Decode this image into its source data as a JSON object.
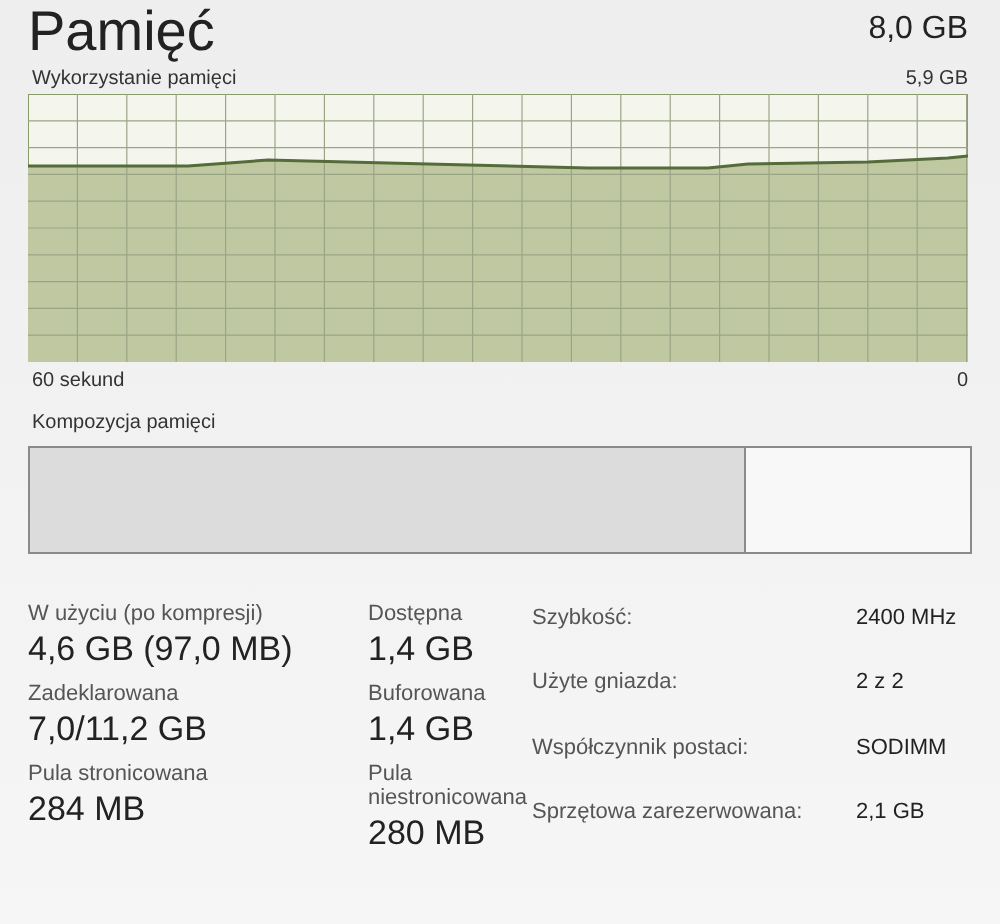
{
  "header": {
    "title": "Pamięć",
    "total": "8,0 GB"
  },
  "usage_graph": {
    "label": "Wykorzystanie pamięci",
    "max": "5,9 GB",
    "time_span": "60 sekund",
    "min": "0"
  },
  "composition": {
    "label": "Kompozycja pamięci",
    "level": 0.76
  },
  "stats": [
    {
      "label": "W użyciu (po kompresji)",
      "value": "4,6 GB (97,0 MB)"
    },
    {
      "label": "Dostępna",
      "value": "1,4 GB"
    },
    {
      "label": "Zadeklarowana",
      "value": "7,0/11,2 GB"
    },
    {
      "label": "Buforowana",
      "value": "1,4 GB"
    },
    {
      "label": "Pula stronicowana",
      "value": "284 MB"
    },
    {
      "label": "Pula niestronicowana",
      "value": "280 MB"
    }
  ],
  "details": [
    {
      "label": "Szybkość:",
      "value": "2400 MHz"
    },
    {
      "label": "Użyte gniazda:",
      "value": "2 z 2"
    },
    {
      "label": "Współczynnik postaci:",
      "value": "SODIMM"
    },
    {
      "label": "Sprzętowa zarezerwowana:",
      "value": "2,1 GB"
    }
  ]
}
